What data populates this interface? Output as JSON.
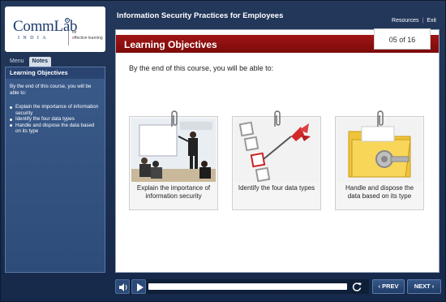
{
  "logo": {
    "main": "CommLab",
    "sub": "INDIA",
    "tag_for": "for",
    "tag_e": "e",
    "tag_rest": "ffective learning"
  },
  "header": {
    "course_title": "Information Security Practices for Employees"
  },
  "top_links": {
    "resources": "Resources",
    "separator": "|",
    "exit": "Exit"
  },
  "sidebar": {
    "tabs": [
      {
        "label": "Menu"
      },
      {
        "label": "Notes"
      }
    ],
    "active_tab": "Notes",
    "heading": "Learning Objectives",
    "intro": "By the end of this course, you will be able to:",
    "items": [
      {
        "label": "Explain the importance of information security"
      },
      {
        "label": "Identify the four data types"
      },
      {
        "label": "Handle and dispose the data based on its type"
      }
    ]
  },
  "content": {
    "title": "Learning Objectives",
    "page_indicator": "05 of 16",
    "intro": "By the end of this course, you will be able to:",
    "cards": [
      {
        "caption": "Explain the importance of information security",
        "image": "presentation-photo"
      },
      {
        "caption": "Identify the four data types",
        "image": "dart-checklist"
      },
      {
        "caption": "Handle and dispose the data based on its type",
        "image": "locked-folder"
      }
    ]
  },
  "footer": {
    "prev_label": "PREV",
    "next_label": "NEXT",
    "prev_glyph": "‹",
    "next_glyph": "›"
  },
  "colors": {
    "frame": "#1b2f4f",
    "title_bar": "#8b1010",
    "sidebar": "#34527f"
  }
}
